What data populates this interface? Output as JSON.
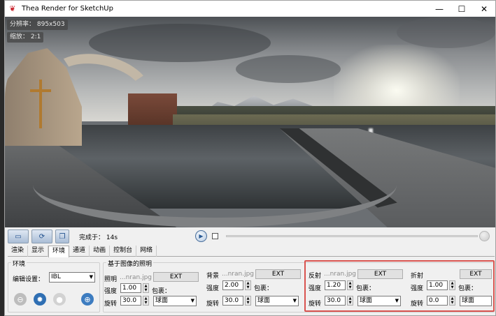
{
  "window": {
    "title": "Thea Render for SketchUp",
    "controls": [
      "—",
      "☐",
      "✕"
    ]
  },
  "render": {
    "resolution": "分辨率： 895x503",
    "zoom": "缩放： 2:1"
  },
  "toolbar": {
    "status": "完成于： 14s"
  },
  "tabs": [
    "渲染",
    "显示",
    "环境",
    "通道",
    "动画",
    "控制台",
    "网络"
  ],
  "env": {
    "group_title": "环境",
    "edit_label": "编辑设置：",
    "edit_value": "IBL"
  },
  "ibl": {
    "group_title": "基于图像的照明",
    "lighting": {
      "label": "照明",
      "file": "...nran.jpg",
      "ext": "EXT",
      "intensity_label": "强度",
      "intensity": "1.00",
      "wrap_label": "包裹：",
      "rotation_label": "旋转",
      "rotation": "30.0",
      "wrap": "球面"
    },
    "background": {
      "label": "背景",
      "file": "...nran.jpg",
      "ext": "EXT",
      "intensity_label": "强度",
      "intensity": "2.00",
      "wrap_label": "包裹：",
      "rotation_label": "旋转",
      "rotation": "30.0",
      "wrap": "球面"
    },
    "reflection": {
      "label": "反射",
      "file": "...nran.jpg",
      "ext": "EXT",
      "intensity_label": "强度",
      "intensity": "1.20",
      "wrap_label": "包裹：",
      "rotation_label": "旋转",
      "rotation": "30.0",
      "wrap": "球面"
    },
    "refraction": {
      "label": "折射",
      "ext": "EXT",
      "intensity_label": "强度",
      "intensity": "1.00",
      "wrap_label": "包裹：",
      "rotation_label": "旋转",
      "rotation": "0.0",
      "wrap": "球面"
    }
  },
  "colors": {
    "highlight": "#d9534f",
    "accent": "#1f4e8c"
  }
}
